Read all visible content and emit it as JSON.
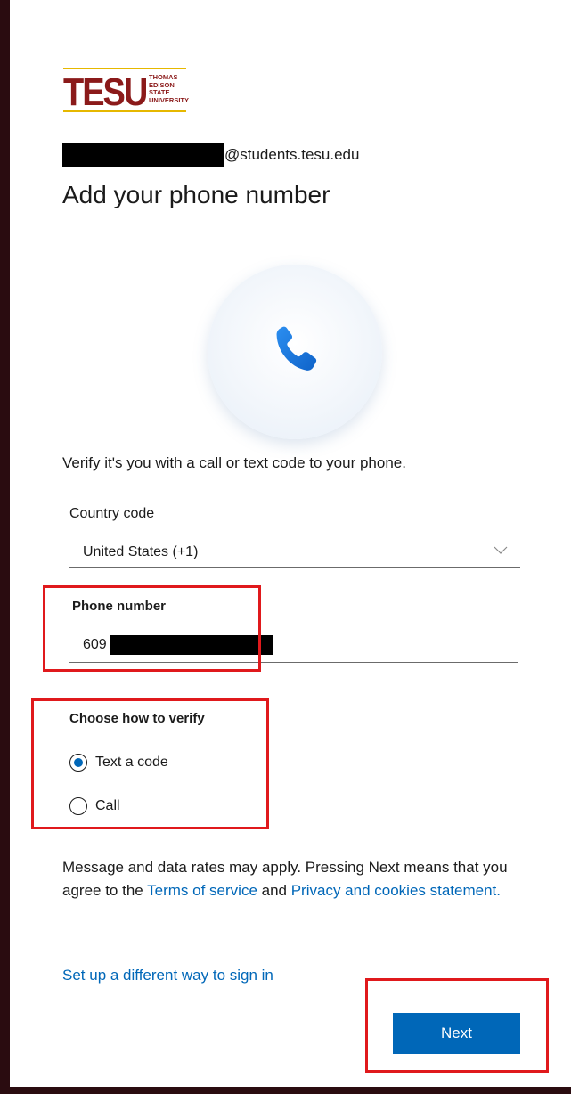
{
  "logo": {
    "word": "TESU",
    "subtitle_lines": [
      "THOMAS",
      "EDISON",
      "STATE",
      "UNIVERSITY"
    ]
  },
  "account": {
    "email_suffix": "@students.tesu.edu"
  },
  "page": {
    "title": "Add your phone number",
    "description": "Verify it's you with a call or text code to your phone.",
    "icon": "phone-icon"
  },
  "form": {
    "country_label": "Country code",
    "country_value": "United States (+1)",
    "phone_label": "Phone number",
    "phone_value_visible": "609",
    "verify_label": "Choose how to verify",
    "options": [
      {
        "label": "Text a code",
        "selected": true
      },
      {
        "label": "Call",
        "selected": false
      }
    ]
  },
  "legal": {
    "text_before": "Message and data rates may apply. Pressing Next means that you agree to the ",
    "terms_link": "Terms of service",
    "text_and": " and ",
    "privacy_link": "Privacy and cookies statement."
  },
  "alternate_link": "Set up a different way to sign in",
  "next_button": "Next",
  "colors": {
    "accent": "#0067b8",
    "highlight": "#e0191c",
    "brand": "#8b1a1a"
  }
}
